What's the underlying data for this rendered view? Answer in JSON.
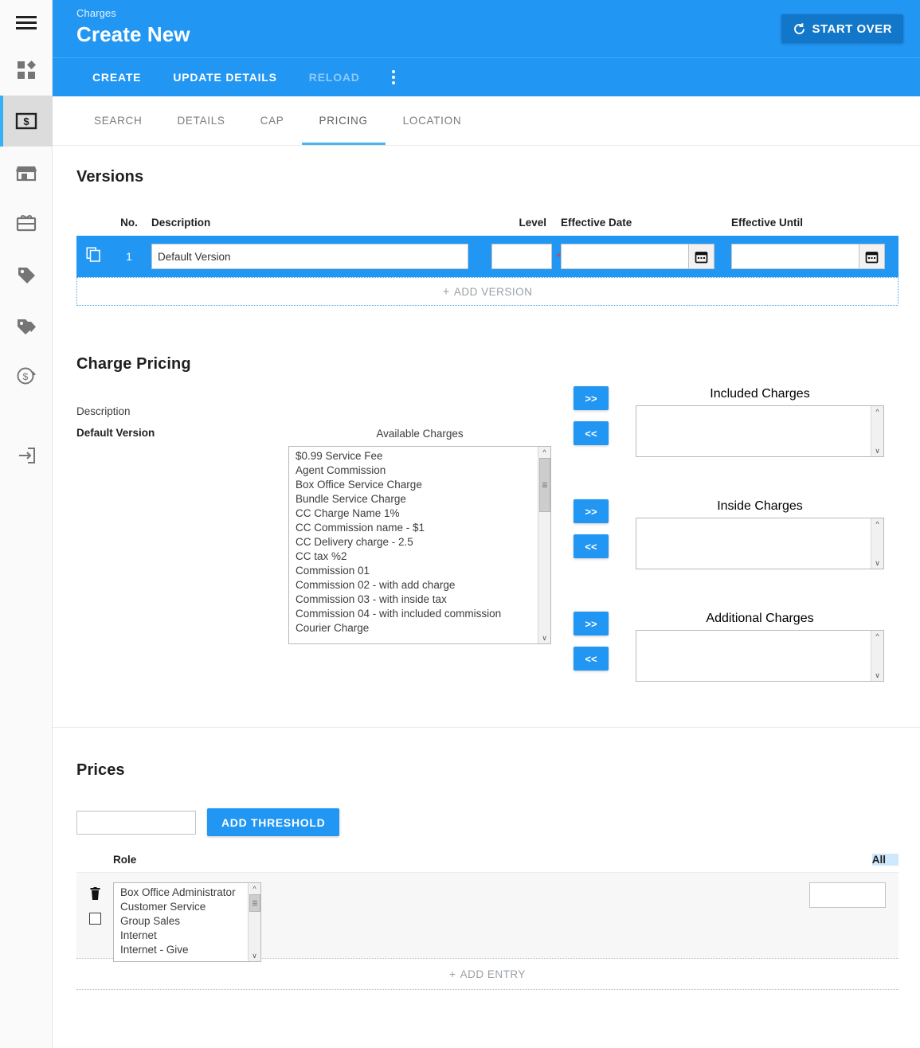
{
  "colors": {
    "primary": "#2196f3",
    "primary_dark": "#1277c9",
    "tab_underline": "#4fb3f0",
    "required_star": "#e53935",
    "sidebar_active_bg": "#dcdcdc",
    "page_bg": "#ffffff"
  },
  "sidebar": {
    "menu_label": "Menu",
    "items": [
      {
        "icon": "dashboard-icon",
        "label": "Dashboard",
        "active": false
      },
      {
        "icon": "charges-money-icon",
        "label": "Charges",
        "active": true
      },
      {
        "icon": "store-icon",
        "label": "Store",
        "active": false
      },
      {
        "icon": "gift-card-icon",
        "label": "Gift Cards",
        "active": false
      },
      {
        "icon": "tag-icon",
        "label": "Tag",
        "active": false
      },
      {
        "icon": "tags-icon",
        "label": "Tags",
        "active": false
      },
      {
        "icon": "refund-dollar-icon",
        "label": "Refunds",
        "active": false
      },
      {
        "icon": "logout-icon",
        "label": "Log Out",
        "active": false
      }
    ]
  },
  "header": {
    "breadcrumb": "Charges",
    "title": "Create New",
    "start_over_label": "START OVER",
    "start_over_icon": "refresh-icon"
  },
  "action_bar": {
    "actions": [
      {
        "label": "CREATE",
        "disabled": false
      },
      {
        "label": "UPDATE DETAILS",
        "disabled": false
      },
      {
        "label": "RELOAD",
        "disabled": true
      }
    ],
    "overflow_icon": "kebab-menu-icon"
  },
  "tabs": [
    {
      "label": "SEARCH",
      "active": false
    },
    {
      "label": "DETAILS",
      "active": false
    },
    {
      "label": "CAP",
      "active": false
    },
    {
      "label": "PRICING",
      "active": true
    },
    {
      "label": "LOCATION",
      "active": false
    }
  ],
  "versions": {
    "heading": "Versions",
    "columns": {
      "no": "No.",
      "description": "Description",
      "level": "Level",
      "effective_date": "Effective Date",
      "effective_until": "Effective Until"
    },
    "rows": [
      {
        "no": "1",
        "description_value": "Default Version",
        "level_value": "",
        "level_required": "*",
        "effective_date_value": "",
        "effective_until_value": "",
        "copy_icon": "copy-icon",
        "calendar_icon": "calendar-icon"
      }
    ],
    "add_label": "ADD VERSION",
    "add_plus": "+"
  },
  "charge_pricing": {
    "heading": "Charge Pricing",
    "description_label": "Description",
    "description_value": "Default Version",
    "available_title": "Available Charges",
    "available_items": [
      "$0.99 Service Fee",
      "Agent Commission",
      "Box Office Service Charge",
      "Bundle Service Charge",
      "CC Charge Name 1%",
      "CC Commission name - $1",
      "CC Delivery charge - 2.5",
      "CC tax %2",
      "Commission 01",
      "Commission 02 - with add charge",
      "Commission 03 - with inside tax",
      "Commission 04 - with included commission",
      "Courier Charge"
    ],
    "add_button": ">>",
    "remove_button": "<<",
    "targets": [
      {
        "title": "Included Charges",
        "items": []
      },
      {
        "title": "Inside Charges",
        "items": []
      },
      {
        "title": "Additional Charges",
        "items": []
      }
    ]
  },
  "prices": {
    "heading": "Prices",
    "threshold_value": "",
    "add_threshold_label": "ADD THRESHOLD",
    "columns": {
      "role": "Role",
      "all": "All"
    },
    "rows": [
      {
        "delete_icon": "trash-icon",
        "checkbox_checked": false,
        "roles": [
          "Box Office Administrator",
          "Customer Service",
          "Group Sales",
          "Internet",
          "Internet - Give"
        ],
        "all_value": ""
      }
    ],
    "add_entry_label": "ADD ENTRY",
    "add_entry_plus": "+"
  }
}
